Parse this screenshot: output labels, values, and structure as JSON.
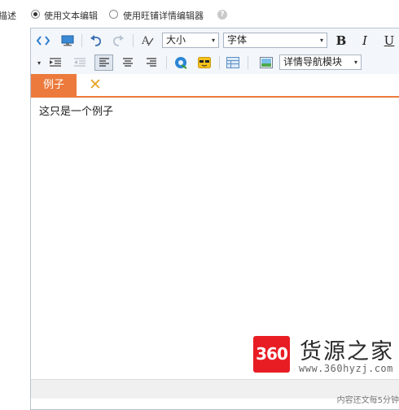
{
  "options": {
    "label_partial": "描述",
    "option1": "使用文本编辑",
    "option2": "使用旺铺详情编辑器",
    "help": "?"
  },
  "toolbar": {
    "size_label": "大小",
    "font_label": "字体",
    "bold": "B",
    "italic": "I",
    "underline": "U",
    "nav_module_label": "详情导航模块",
    "arrow": "▾"
  },
  "tabs": [
    {
      "label": "例子",
      "active": true
    },
    {
      "label": "✕",
      "role": "close"
    }
  ],
  "editor": {
    "content": "这只是一个例子"
  },
  "footer": {
    "text": "内容还文每5分钟"
  },
  "watermark": {
    "badge": "360",
    "title": "货源之家",
    "url": "www.360hyzj.com"
  },
  "colors": {
    "accent": "#ec7a3c",
    "close_icon": "#e8a626",
    "watermark_red": "#e81d23"
  }
}
